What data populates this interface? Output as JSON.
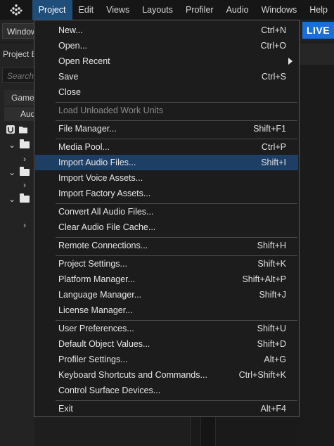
{
  "menubar": {
    "items": [
      "Project",
      "Edit",
      "Views",
      "Layouts",
      "Profiler",
      "Audio",
      "Windows",
      "Help"
    ],
    "active": "Project"
  },
  "toolbar": {
    "window_label": "Window",
    "live_label": "LIVE"
  },
  "left_panel": {
    "title": "Project E",
    "search_placeholder": "Search",
    "tab_game": "Game",
    "tab_audio": "Audio"
  },
  "menu": {
    "new": {
      "label": "New...",
      "shortcut": "Ctrl+N"
    },
    "open": {
      "label": "Open...",
      "shortcut": "Ctrl+O"
    },
    "open_recent": {
      "label": "Open Recent"
    },
    "save": {
      "label": "Save",
      "shortcut": "Ctrl+S"
    },
    "close": {
      "label": "Close"
    },
    "load_unloaded": {
      "label": "Load Unloaded Work Units"
    },
    "file_manager": {
      "label": "File Manager...",
      "shortcut": "Shift+F1"
    },
    "media_pool": {
      "label": "Media Pool...",
      "shortcut": "Ctrl+P"
    },
    "import_audio": {
      "label": "Import Audio Files...",
      "shortcut": "Shift+I"
    },
    "import_voice": {
      "label": "Import Voice Assets..."
    },
    "import_factory": {
      "label": "Import Factory Assets..."
    },
    "convert_audio": {
      "label": "Convert All Audio Files..."
    },
    "clear_cache": {
      "label": "Clear Audio File Cache..."
    },
    "remote_connections": {
      "label": "Remote Connections...",
      "shortcut": "Shift+H"
    },
    "project_settings": {
      "label": "Project Settings...",
      "shortcut": "Shift+K"
    },
    "platform_manager": {
      "label": "Platform Manager...",
      "shortcut": "Shift+Alt+P"
    },
    "language_manager": {
      "label": "Language Manager...",
      "shortcut": "Shift+J"
    },
    "license_manager": {
      "label": "License Manager..."
    },
    "user_preferences": {
      "label": "User Preferences...",
      "shortcut": "Shift+U"
    },
    "default_object_values": {
      "label": "Default Object Values...",
      "shortcut": "Shift+D"
    },
    "profiler_settings": {
      "label": "Profiler Settings...",
      "shortcut": "Alt+G"
    },
    "keyboard_shortcuts": {
      "label": "Keyboard Shortcuts and Commands...",
      "shortcut": "Ctrl+Shift+K"
    },
    "control_surface": {
      "label": "Control Surface Devices..."
    },
    "exit": {
      "label": "Exit",
      "shortcut": "Alt+F4"
    }
  },
  "colors": {
    "accent": "#1f4e7a",
    "highlight": "#1d3f66",
    "live": "#1a6fd6"
  }
}
